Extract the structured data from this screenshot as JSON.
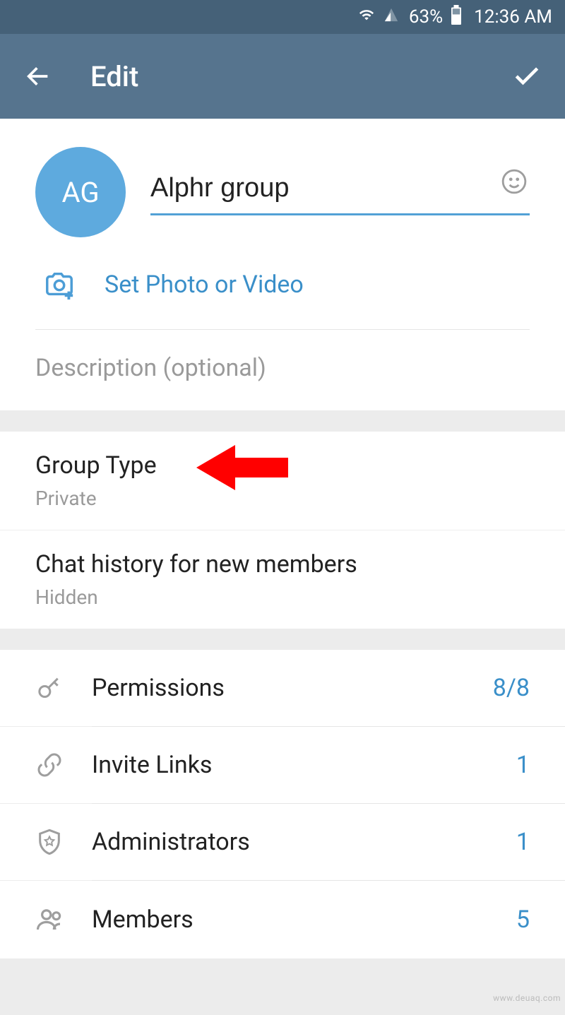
{
  "status": {
    "battery_pct": "63%",
    "time": "12:36 AM"
  },
  "header": {
    "title": "Edit"
  },
  "profile": {
    "avatar_initials": "AG",
    "group_name": "Alphr group",
    "set_photo_label": "Set Photo or Video",
    "description_placeholder": "Description (optional)"
  },
  "settings": {
    "group_type": {
      "title": "Group Type",
      "value": "Private"
    },
    "chat_history": {
      "title": "Chat history for new members",
      "value": "Hidden"
    }
  },
  "rows": {
    "permissions": {
      "label": "Permissions",
      "value": "8/8"
    },
    "invite_links": {
      "label": "Invite Links",
      "value": "1"
    },
    "administrators": {
      "label": "Administrators",
      "value": "1"
    },
    "members": {
      "label": "Members",
      "value": "5"
    }
  },
  "watermark": "www.deuaq.com"
}
